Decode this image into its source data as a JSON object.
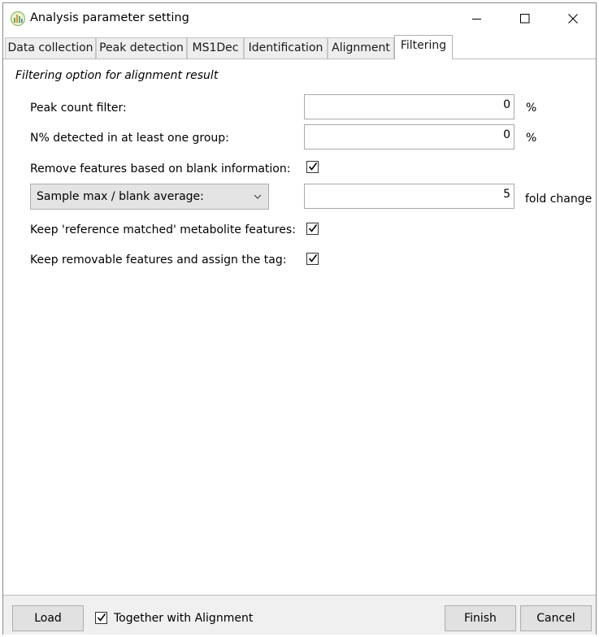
{
  "window": {
    "title": "Analysis parameter setting",
    "icon": "msdial-app-icon",
    "controls": [
      "minimize-icon",
      "maximize-icon",
      "close-icon"
    ]
  },
  "tabs": [
    {
      "label": "Data collection",
      "active": false
    },
    {
      "label": "Peak detection",
      "active": false
    },
    {
      "label": "MS1Dec",
      "active": false
    },
    {
      "label": "Identification",
      "active": false
    },
    {
      "label": "Alignment",
      "active": false
    },
    {
      "label": "Filtering",
      "active": true
    }
  ],
  "filtering": {
    "section_title": "Filtering option for alignment result",
    "peak_count": {
      "label": "Peak count filter:",
      "value": "0",
      "unit": "%"
    },
    "n_percent": {
      "label": "N% detected in at least one group:",
      "value": "0",
      "unit": "%"
    },
    "remove_blank": {
      "label": "Remove features based on blank information:",
      "checked": true
    },
    "blank_mode": {
      "selected": "Sample max / blank average:",
      "value": "5",
      "unit": "fold change"
    },
    "keep_reference": {
      "label": "Keep 'reference matched' metabolite features:",
      "checked": true
    },
    "keep_removable": {
      "label": "Keep removable features and assign the tag:",
      "checked": true
    }
  },
  "footer": {
    "load_label": "Load",
    "together_label": "Together with Alignment",
    "together_checked": true,
    "finish_label": "Finish",
    "cancel_label": "Cancel"
  }
}
